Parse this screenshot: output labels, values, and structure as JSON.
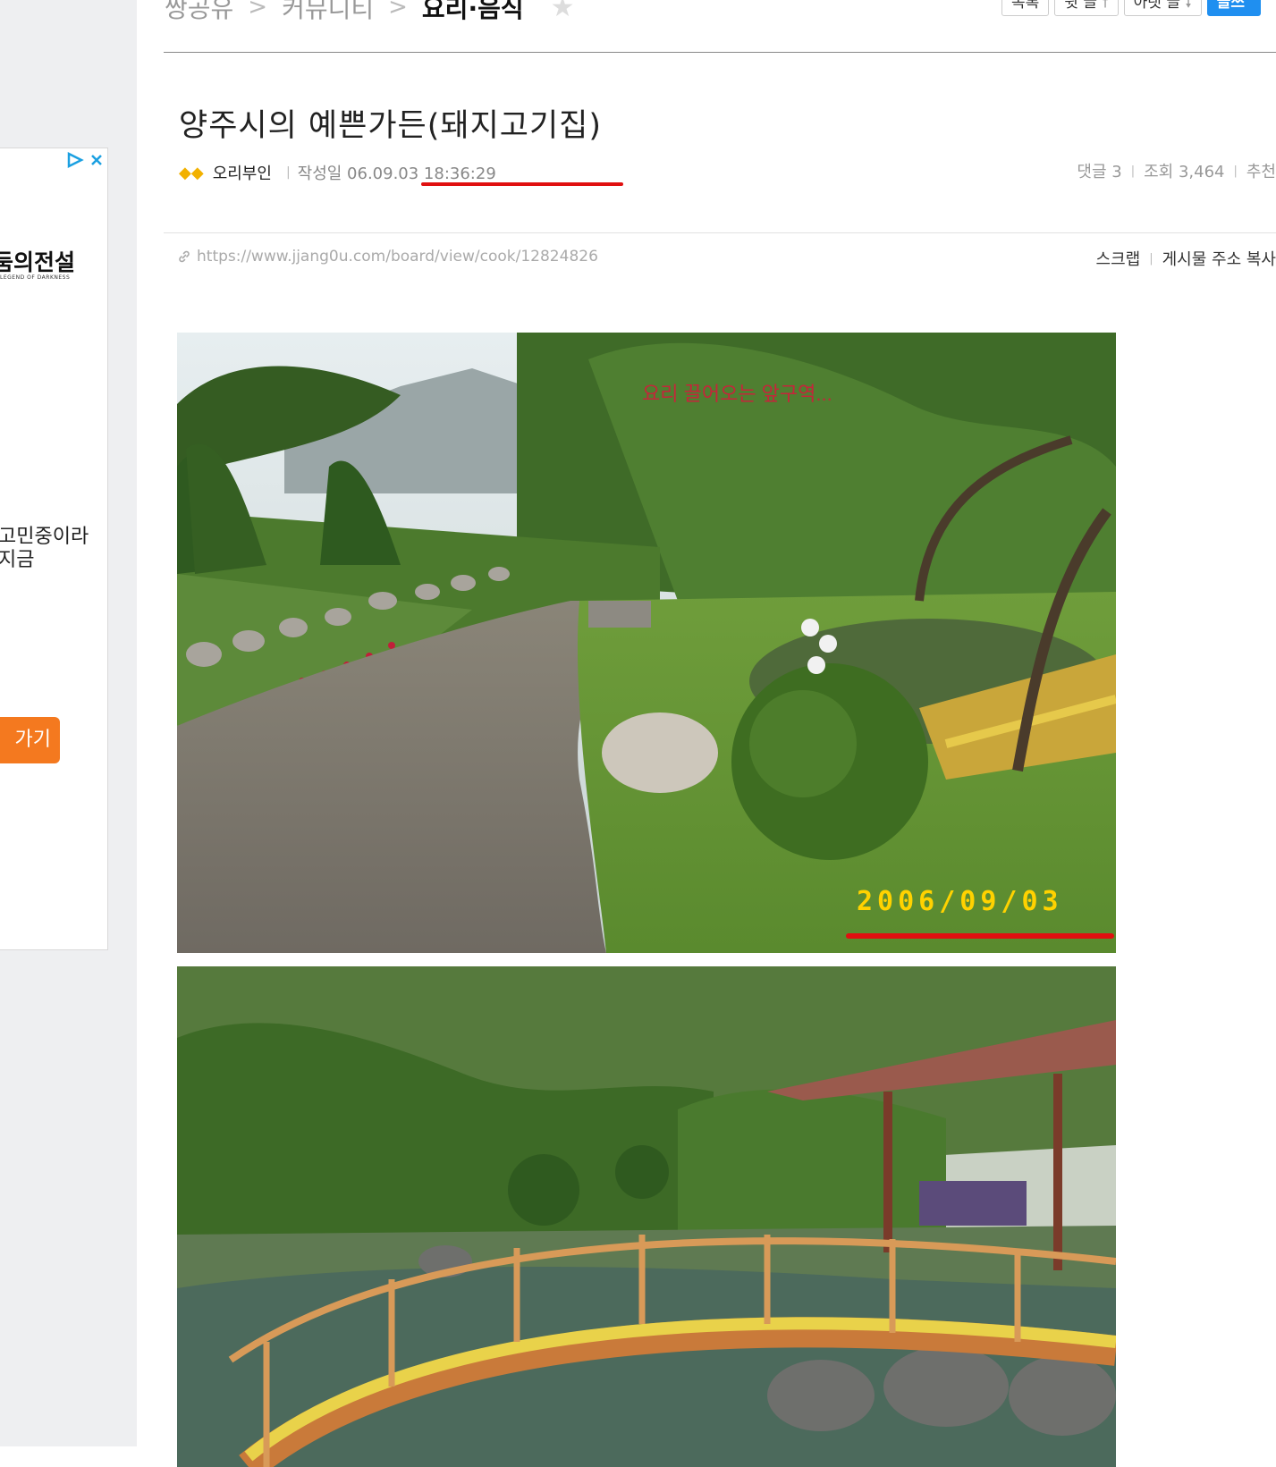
{
  "ad": {
    "logo_text": "둠의전설",
    "logo_sub": "LEGEND OF DARKNESS",
    "text_line1": "고민중이라",
    "text_line2": "지금",
    "cta_label": "가기"
  },
  "breadcrumb": {
    "items": [
      "쌍공유",
      "커뮤니티",
      "요리·음식"
    ]
  },
  "toolbar": {
    "buttons": [
      "목록",
      "윗 글",
      "아랫 글",
      "글쓰"
    ]
  },
  "post": {
    "title": "양주시의 예쁜가든(돼지고기집)",
    "author": "오리부인",
    "date_label": "작성일 06.09.03 18:36:29",
    "stats": {
      "comments": "댓글 3",
      "views": "조회 3,464",
      "recommend": "추천"
    },
    "url": "https://www.jjang0u.com/board/view/cook/12824826",
    "actions": {
      "scrap": "스크랩",
      "copy_url": "게시물 주소 복사"
    }
  },
  "photos": {
    "photo1_caption": "요리 끌어오는 앞구역...",
    "photo1_stamp": "2006/09/03"
  },
  "colors": {
    "accent_blue": "#1f8ff0",
    "cta_orange": "#f4791f",
    "highlight_red": "#e01010"
  }
}
